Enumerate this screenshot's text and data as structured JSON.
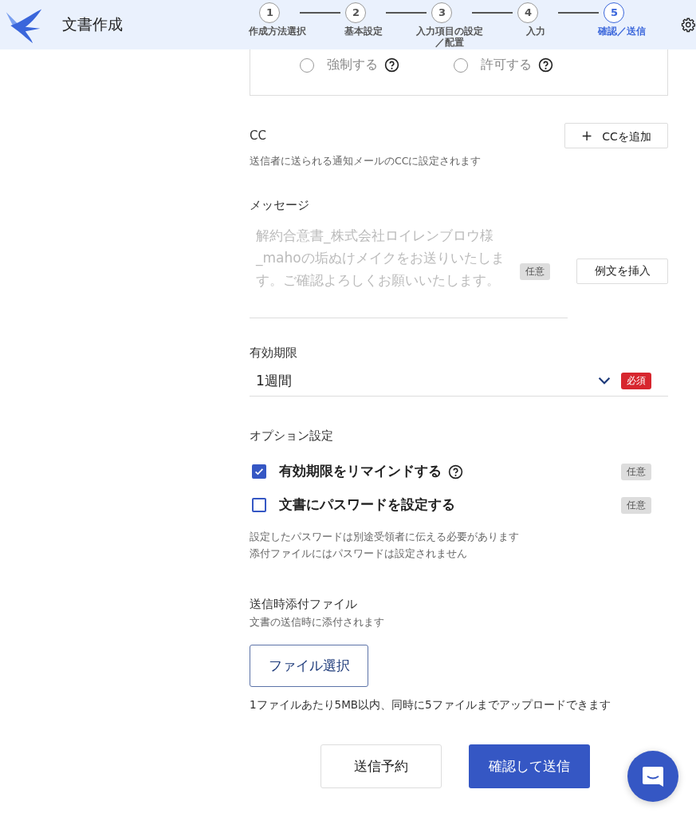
{
  "header": {
    "title": "文書作成"
  },
  "steps": [
    {
      "number": "1",
      "label": "作成方法選択",
      "current": false
    },
    {
      "number": "2",
      "label": "基本設定",
      "current": false
    },
    {
      "number": "3",
      "label": "入力項目の設定／配置",
      "current": false
    },
    {
      "number": "4",
      "label": "入力",
      "current": false
    },
    {
      "number": "5",
      "label": "確認／送信",
      "current": true
    }
  ],
  "radios": [
    {
      "label": "強制する",
      "selected": false
    },
    {
      "label": "許可する",
      "selected": false
    }
  ],
  "cc": {
    "label": "CC",
    "button": "CCを追加",
    "plus": "+",
    "description": "送信者に送られる通知メールのCCに設定されます"
  },
  "message": {
    "label": "メッセージ",
    "placeholder": "解約合意書_株式会社ロイレンブロウ様_mahoの垢ぬけメイクをお送りいたします。ご確認よろしくお願いいたします。",
    "badge": "任意",
    "button": "例文を挿入"
  },
  "expiry": {
    "label": "有効期限",
    "value": "1週間",
    "badge": "必須"
  },
  "options": {
    "label": "オプション設定",
    "items": [
      {
        "label": "有効期限をリマインドする",
        "checked": true,
        "help": true,
        "badge": "任意"
      },
      {
        "label": "文書にパスワードを設定する",
        "checked": false,
        "help": false,
        "badge": "任意"
      }
    ],
    "notes": [
      "設定したパスワードは別途受領者に伝える必要があります",
      "添付ファイルにはパスワードは設定されません"
    ]
  },
  "attachment": {
    "label": "送信時添付ファイル",
    "description": "文書の送信時に添付されます",
    "button": "ファイル選択",
    "note": "1ファイルあたり5MB以内、同時に5ファイルまでアップロードできます"
  },
  "actions": [
    {
      "label": "送信予約",
      "kind": "secondary"
    },
    {
      "label": "確認して送信",
      "kind": "primary"
    }
  ]
}
